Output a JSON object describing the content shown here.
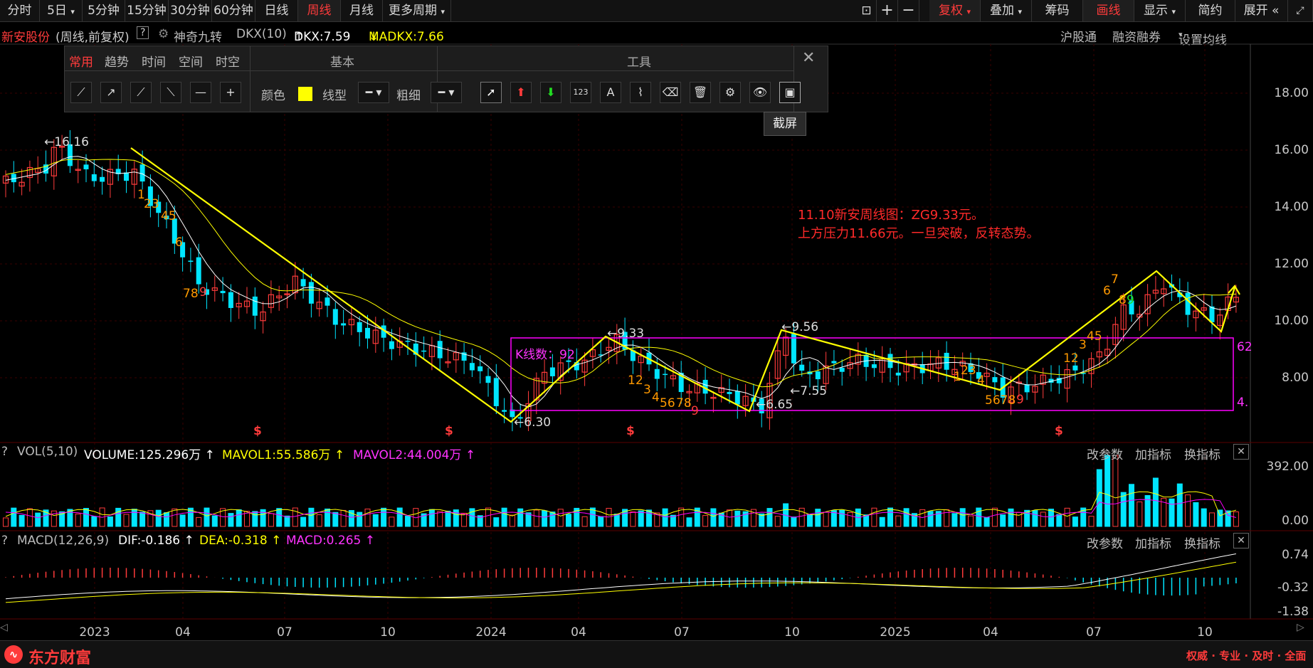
{
  "toolbar": {
    "periods": [
      "分时",
      "5日",
      "5分钟",
      "15分钟",
      "30分钟",
      "60分钟",
      "日线",
      "周线",
      "月线",
      "更多周期"
    ],
    "active_period": "周线",
    "right_buttons": [
      "复权",
      "叠加",
      "筹码",
      "画线",
      "显示",
      "简约",
      "展开"
    ]
  },
  "info": {
    "stock_name": "新安股份",
    "mode": "(周线,前复权)",
    "help": "?",
    "indicator_name": "神奇九转",
    "dkx_label": "DKX(10)",
    "dkx_value": "DKX:7.59",
    "madkx_value": "MADKX:7.66",
    "links": [
      "沪股通",
      "融资融券",
      "设置均线"
    ]
  },
  "drawbar": {
    "tabs": [
      "常用",
      "趋势",
      "时间",
      "空间",
      "时空"
    ],
    "section_basic": "基本",
    "section_tools": "工具",
    "color_label": "颜色",
    "linetype_label": "线型",
    "thickness_label": "粗细",
    "tooltip": "截屏"
  },
  "main_chart": {
    "y_ticks": [
      "18.00",
      "16.00",
      "14.00",
      "12.00",
      "10.00",
      "8.00"
    ],
    "annotation_line1": "11.10新安周线图：ZG9.33元。",
    "annotation_line2": "上方压力11.66元。一旦突破，反转态势。",
    "box_label": "K线数：92",
    "box_right_top": "62",
    "box_right_bottom": "4.",
    "price_labels": [
      "16.16",
      "6.30",
      "9.33",
      "6.65",
      "9.56",
      "7.55"
    ],
    "seq_labels": [
      {
        "t": "1",
        "c": "#ff9900"
      },
      {
        "t": "23",
        "c": "#ff9900"
      },
      {
        "t": "45",
        "c": "#ff9900"
      },
      {
        "t": "6",
        "c": "#ff9900"
      },
      {
        "t": "78",
        "c": "#ff9900"
      },
      {
        "t": "9",
        "c": "#ff3b3b"
      },
      {
        "t": "1",
        "c": "#ff9900"
      },
      {
        "t": "2",
        "c": "#ff9900"
      },
      {
        "t": "3",
        "c": "#ff9900"
      },
      {
        "t": "4",
        "c": "#ff9900"
      },
      {
        "t": "56",
        "c": "#ff9900"
      },
      {
        "t": "78",
        "c": "#ff9900"
      },
      {
        "t": "9",
        "c": "#ff3b3b"
      },
      {
        "t": "1",
        "c": "#ff9900"
      },
      {
        "t": "23",
        "c": "#ff9900"
      },
      {
        "t": "4",
        "c": "#ff9900"
      },
      {
        "t": "5678",
        "c": "#ff9900"
      },
      {
        "t": "9",
        "c": "#ff3b3b"
      },
      {
        "t": "12",
        "c": "#ff9900"
      },
      {
        "t": "3",
        "c": "#ff9900"
      },
      {
        "t": "45",
        "c": "#ff9900"
      },
      {
        "t": "6",
        "c": "#ff9900"
      },
      {
        "t": "7",
        "c": "#ff9900"
      },
      {
        "t": "8",
        "c": "#ff9900"
      },
      {
        "t": "9",
        "c": "#22dd22"
      }
    ],
    "dollar_mark": "$"
  },
  "volume": {
    "label": "VOL(5,10)",
    "volume": "VOLUME:125.296万",
    "mavol1": "MAVOL1:55.586万",
    "mavol2": "MAVOL2:44.004万",
    "y_ticks": [
      "392.00",
      "0.00"
    ],
    "btns": [
      "改参数",
      "加指标",
      "换指标"
    ]
  },
  "macd": {
    "label": "MACD(12,26,9)",
    "dif": "DIF:-0.186",
    "dea": "DEA:-0.318",
    "macd": "MACD:0.265",
    "y_ticks": [
      "0.74",
      "-0.32",
      "-1.38"
    ],
    "btns": [
      "改参数",
      "加指标",
      "换指标"
    ]
  },
  "x_axis": [
    "2023",
    "04",
    "07",
    "10",
    "2024",
    "04",
    "07",
    "10",
    "2025",
    "04",
    "07",
    "10"
  ],
  "footer": {
    "brand": "东方财富",
    "slogan": "权威 · 专业 · 及时 · 全面"
  },
  "colors": {
    "up": "#ff3b3b",
    "down": "#00e5ff",
    "yellow": "#ffff00",
    "magenta": "#ff00ff",
    "orange": "#ff9900"
  }
}
